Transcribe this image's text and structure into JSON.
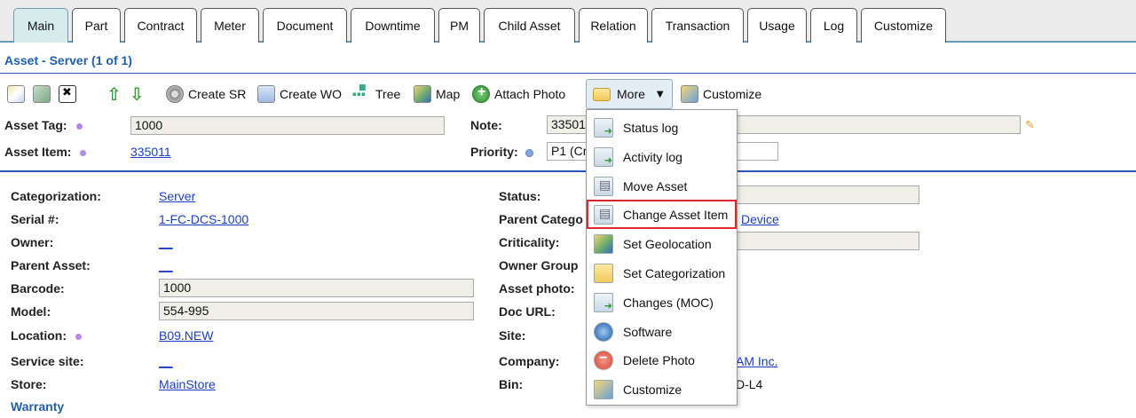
{
  "tabs": [
    {
      "label": "Main",
      "active": true
    },
    {
      "label": "Part",
      "active": false
    },
    {
      "label": "Contract",
      "active": false
    },
    {
      "label": "Meter",
      "active": false
    },
    {
      "label": "Document",
      "active": false
    },
    {
      "label": "Downtime",
      "active": false
    },
    {
      "label": "PM",
      "active": false
    },
    {
      "label": "Child Asset",
      "active": false
    },
    {
      "label": "Relation",
      "active": false
    },
    {
      "label": "Transaction",
      "active": false
    },
    {
      "label": "Usage",
      "active": false
    },
    {
      "label": "Log",
      "active": false
    },
    {
      "label": "Customize",
      "active": false
    }
  ],
  "header": {
    "title": "Asset - Server (1 of 1)"
  },
  "toolbar": {
    "create_sr": "Create SR",
    "create_wo": "Create WO",
    "tree": "Tree",
    "map": "Map",
    "attach_photo": "Attach Photo",
    "more": "More",
    "customize": "Customize"
  },
  "top_fields": {
    "asset_tag_label": "Asset Tag:",
    "asset_tag_value": "1000",
    "asset_item_label": "Asset Item:",
    "asset_item_value": "335011",
    "note_label": "Note:",
    "note_value": "33501",
    "priority_label": "Priority:",
    "priority_value": "P1 (Cr"
  },
  "left_fields": {
    "categorization_label": "Categorization:",
    "categorization_value": "Server",
    "serial_label": "Serial #:",
    "serial_value": "1-FC-DCS-1000",
    "owner_label": "Owner:",
    "owner_value": "__",
    "parent_asset_label": "Parent Asset:",
    "parent_asset_value": "__",
    "barcode_label": "Barcode:",
    "barcode_value": "1000",
    "model_label": "Model:",
    "model_value": "554-995",
    "location_label": "Location:",
    "location_value": "B09.NEW",
    "service_site_label": "Service site:",
    "service_site_value": "__",
    "store_label": "Store:",
    "store_value": "MainStore"
  },
  "right_fields": {
    "status_label": "Status:",
    "parent_category_label": "Parent Catego",
    "parent_category_value": "Device",
    "criticality_label": "Criticality:",
    "owner_group_label": "Owner Group",
    "asset_photo_label": "Asset photo:",
    "doc_url_label": "Doc URL:",
    "site_label": "Site:",
    "company_label": "Company:",
    "company_value": "AM Inc.",
    "bin_label": "Bin:",
    "bin_value": "D-L4"
  },
  "warranty_label": "Warranty",
  "more_menu": {
    "status_log": "Status log",
    "activity_log": "Activity log",
    "move_asset": "Move Asset",
    "change_asset_item": "Change Asset Item",
    "set_geolocation": "Set Geolocation",
    "set_categorization": "Set Categorization",
    "changes_moc": "Changes (MOC)",
    "software": "Software",
    "delete_photo": "Delete Photo",
    "customize": "Customize"
  },
  "colors": {
    "link": "#1a3fc4",
    "title": "#1f5fad",
    "highlight": "#e0262d",
    "active_tab": "#d6ecec"
  }
}
